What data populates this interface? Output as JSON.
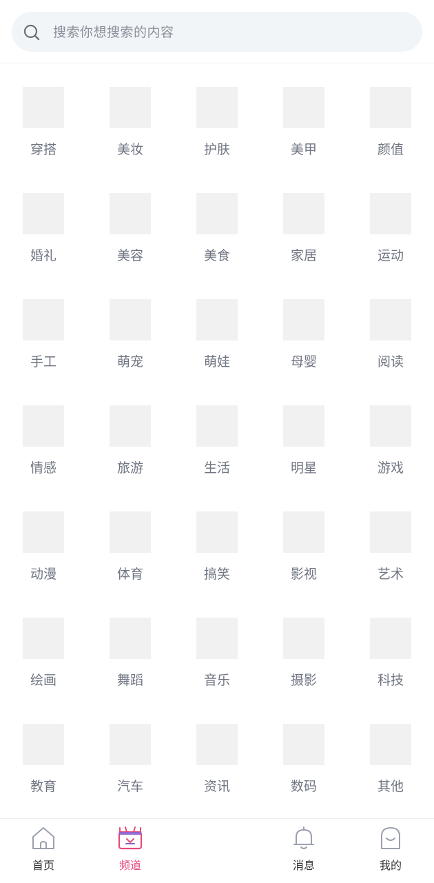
{
  "search": {
    "placeholder": "搜索你想搜索的内容"
  },
  "channels": [
    "穿搭",
    "美妆",
    "护肤",
    "美甲",
    "颜值",
    "婚礼",
    "美容",
    "美食",
    "家居",
    "运动",
    "手工",
    "萌宠",
    "萌娃",
    "母婴",
    "阅读",
    "情感",
    "旅游",
    "生活",
    "明星",
    "游戏",
    "动漫",
    "体育",
    "搞笑",
    "影视",
    "艺术",
    "绘画",
    "舞蹈",
    "音乐",
    "摄影",
    "科技",
    "教育",
    "汽车",
    "资讯",
    "数码",
    "其他"
  ],
  "tabbar": {
    "home": {
      "label": "首页",
      "icon": "home-icon"
    },
    "channel": {
      "label": "频道",
      "icon": "tv-icon"
    },
    "publish": {
      "icon": "plus-icon"
    },
    "messages": {
      "label": "消息",
      "icon": "bell-icon"
    },
    "me": {
      "label": "我的",
      "icon": "user-icon"
    }
  },
  "colors": {
    "accent": "#e8497a",
    "accent_purple": "#8a5fd0",
    "icon_gray": "#9aa0ae"
  }
}
